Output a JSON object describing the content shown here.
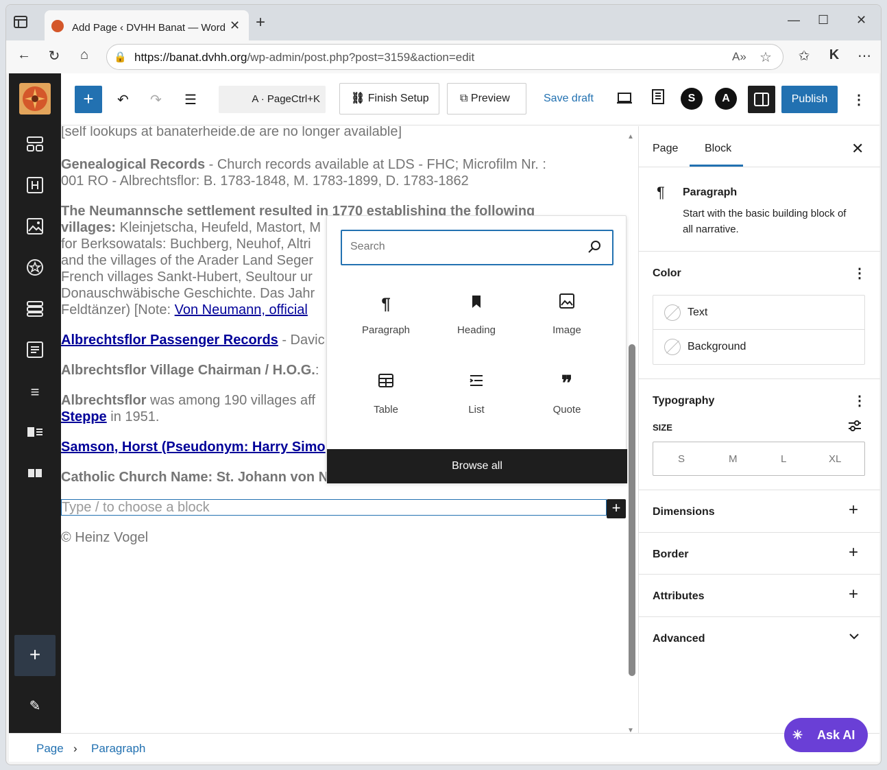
{
  "browser": {
    "tab_title": "Add Page ‹ DVHH Banat — WordPress",
    "url_host": "https://banat.dvhh.org",
    "url_path": "/wp-admin/post.php?post=3159&action=edit"
  },
  "toolbar": {
    "command_label": "A · PageCtrl+K",
    "finish_setup": "Finish Setup",
    "preview": "Preview",
    "save_draft": "Save draft",
    "publish": "Publish"
  },
  "content": {
    "line1": "[self lookups at banaterheide.de are no longer available]",
    "genealogical_bold": "Genealogical Records",
    "genealogical_rest": " - Church records available at LDS - FHC; Microfilm Nr. :",
    "genealogical_line2": "001 RO - Albrechtsflor: B. 1783-1848, M. 1783-1899, D. 1783-1862",
    "neumann_bold1": "The Neumannsche settlement resulted in 1770 establishing the following",
    "neumann_bold2": "villages:",
    "neumann_rest2": " Kleinjetscha, Heufeld, Mastort, M",
    "neumann_line3": "for Berksowatals: Buchberg, Neuhof, Altri",
    "neumann_line4": "and the villages of the Arader Land Seger",
    "neumann_line5": "French villages Sankt-Hubert, Seultour ur",
    "neumann_line6": "Donauschwäbische Geschichte. Das Jahr",
    "neumann_line7a": "Feldtänzer) [Note: ",
    "neumann_link": "Von Neumann, official",
    "passenger_link": "Albrechtsflor Passenger Records",
    "passenger_rest": " - Davic",
    "chairman": "Albrechtsflor Village Chairman / H.O.G.",
    "chairman_colon": ":",
    "among_bold": "Albrechtsflor",
    "among_rest": " was among 190 villages aff",
    "steppe_link": "Steppe",
    "steppe_rest": " in 1951.",
    "samson_link": "Samson, Horst (Pseudonym: Harry Simo",
    "church": "Catholic Church Name: St. Johann von N",
    "type_placeholder": "Type / to choose a block",
    "copyright": "© Heinz Vogel"
  },
  "inserter": {
    "search_placeholder": "Search",
    "blocks": [
      "Paragraph",
      "Heading",
      "Image",
      "Table",
      "List",
      "Quote"
    ],
    "browse_all": "Browse all"
  },
  "sidebar": {
    "tab_page": "Page",
    "tab_block": "Block",
    "block_title": "Paragraph",
    "block_desc1": "Start with the basic building block of",
    "block_desc2": "all narrative.",
    "color": "Color",
    "color_text": "Text",
    "color_background": "Background",
    "typography": "Typography",
    "size": "SIZE",
    "sizes": [
      "S",
      "M",
      "L",
      "XL"
    ],
    "dimensions": "Dimensions",
    "border": "Border",
    "attributes": "Attributes",
    "advanced": "Advanced"
  },
  "status": {
    "crumb1": "Page",
    "sep": "›",
    "crumb2": "Paragraph"
  },
  "ask_ai": "Ask AI",
  "colors": {
    "accent": "#2271b1",
    "dark": "#1e1e1e",
    "ask_ai": "#6a3fd6",
    "link": "#000099"
  }
}
